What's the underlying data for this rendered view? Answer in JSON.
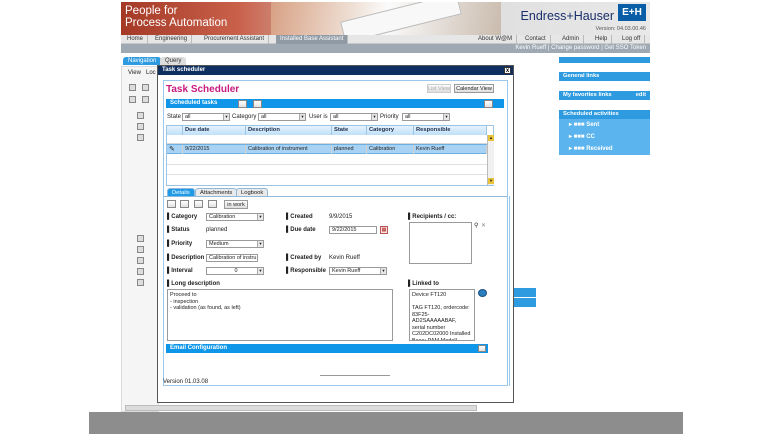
{
  "banner": {
    "tagline_line1": "People for",
    "tagline_line2": "Process Automation",
    "brand": "Endress+Hauser",
    "logo": "E+H",
    "version": "Version: 04.03.00.46"
  },
  "topnav": {
    "items": [
      "Home",
      "Engineering",
      "Procurement Assistant",
      "Installed Base Assistant"
    ],
    "right": [
      "About W@M",
      "Contact",
      "Admin",
      "Help",
      "Log off"
    ]
  },
  "userbar": {
    "text": "Kevin Rueff | Change password | Get SSO Token"
  },
  "left": {
    "tab_navigation": "Navigation",
    "tab_query": "Query",
    "view_label": "View",
    "view_label2": "Loc"
  },
  "right": {
    "general_links": "General links",
    "favorites": "My favorites links",
    "favorites_edit": "edit",
    "scheduled": "Scheduled activities",
    "sent": "Sent",
    "cc": "CC",
    "received": "Received"
  },
  "dialog": {
    "window_title": "Task scheduler",
    "title": "Task Scheduler",
    "list_view": "List View",
    "calendar_view": "Calendar View",
    "section_scheduled": "Scheduled tasks",
    "filters": {
      "state_label": "State",
      "state_value": "all",
      "category_label": "Category",
      "category_value": "all",
      "user_label": "User is",
      "user_value": "all",
      "priority_label": "Priority",
      "priority_value": "all"
    },
    "table": {
      "headers": [
        "Due date",
        "Description",
        "State",
        "Category",
        "Responsible"
      ],
      "rows": [
        {
          "due": "9/22/2015",
          "description": "Calibration of instrument",
          "state": "planned",
          "category": "Calibration",
          "responsible": "Kevin Rueff"
        }
      ]
    },
    "tabs": [
      "Details",
      "Attachments",
      "Logbook"
    ],
    "in_work": "in work",
    "details": {
      "category_label": "Category",
      "category_value": "Calibration",
      "status_label": "Status",
      "status_value": "planned",
      "priority_label": "Priority",
      "priority_value": "Medium",
      "description_label": "Description",
      "description_value": "Calibration of instru",
      "interval_label": "Interval",
      "interval_value": "0",
      "created_label": "Created",
      "created_value": "9/9/2015",
      "due_label": "Due date",
      "due_value": "9/22/2015",
      "createdby_label": "Created by",
      "createdby_value": "Kevin Rueff",
      "responsible_label": "Responsible",
      "responsible_value": "Kevin Rueff",
      "recipients_label": "Recipients / cc:",
      "long_desc_label": "Long description",
      "long_desc_value": "Proceed to\n- inspection\n- validation (as found, as left)",
      "linked_label": "Linked to",
      "linked_value": "Device FT120\n\nTAG FT120, ordercode:\n83F25-AD2SAAAAABAF,\nserial number\nC202DC02000 Installed\nBase: PAM Modell"
    },
    "email_config": "Email Configuration",
    "version": "Version 01.03.08"
  }
}
